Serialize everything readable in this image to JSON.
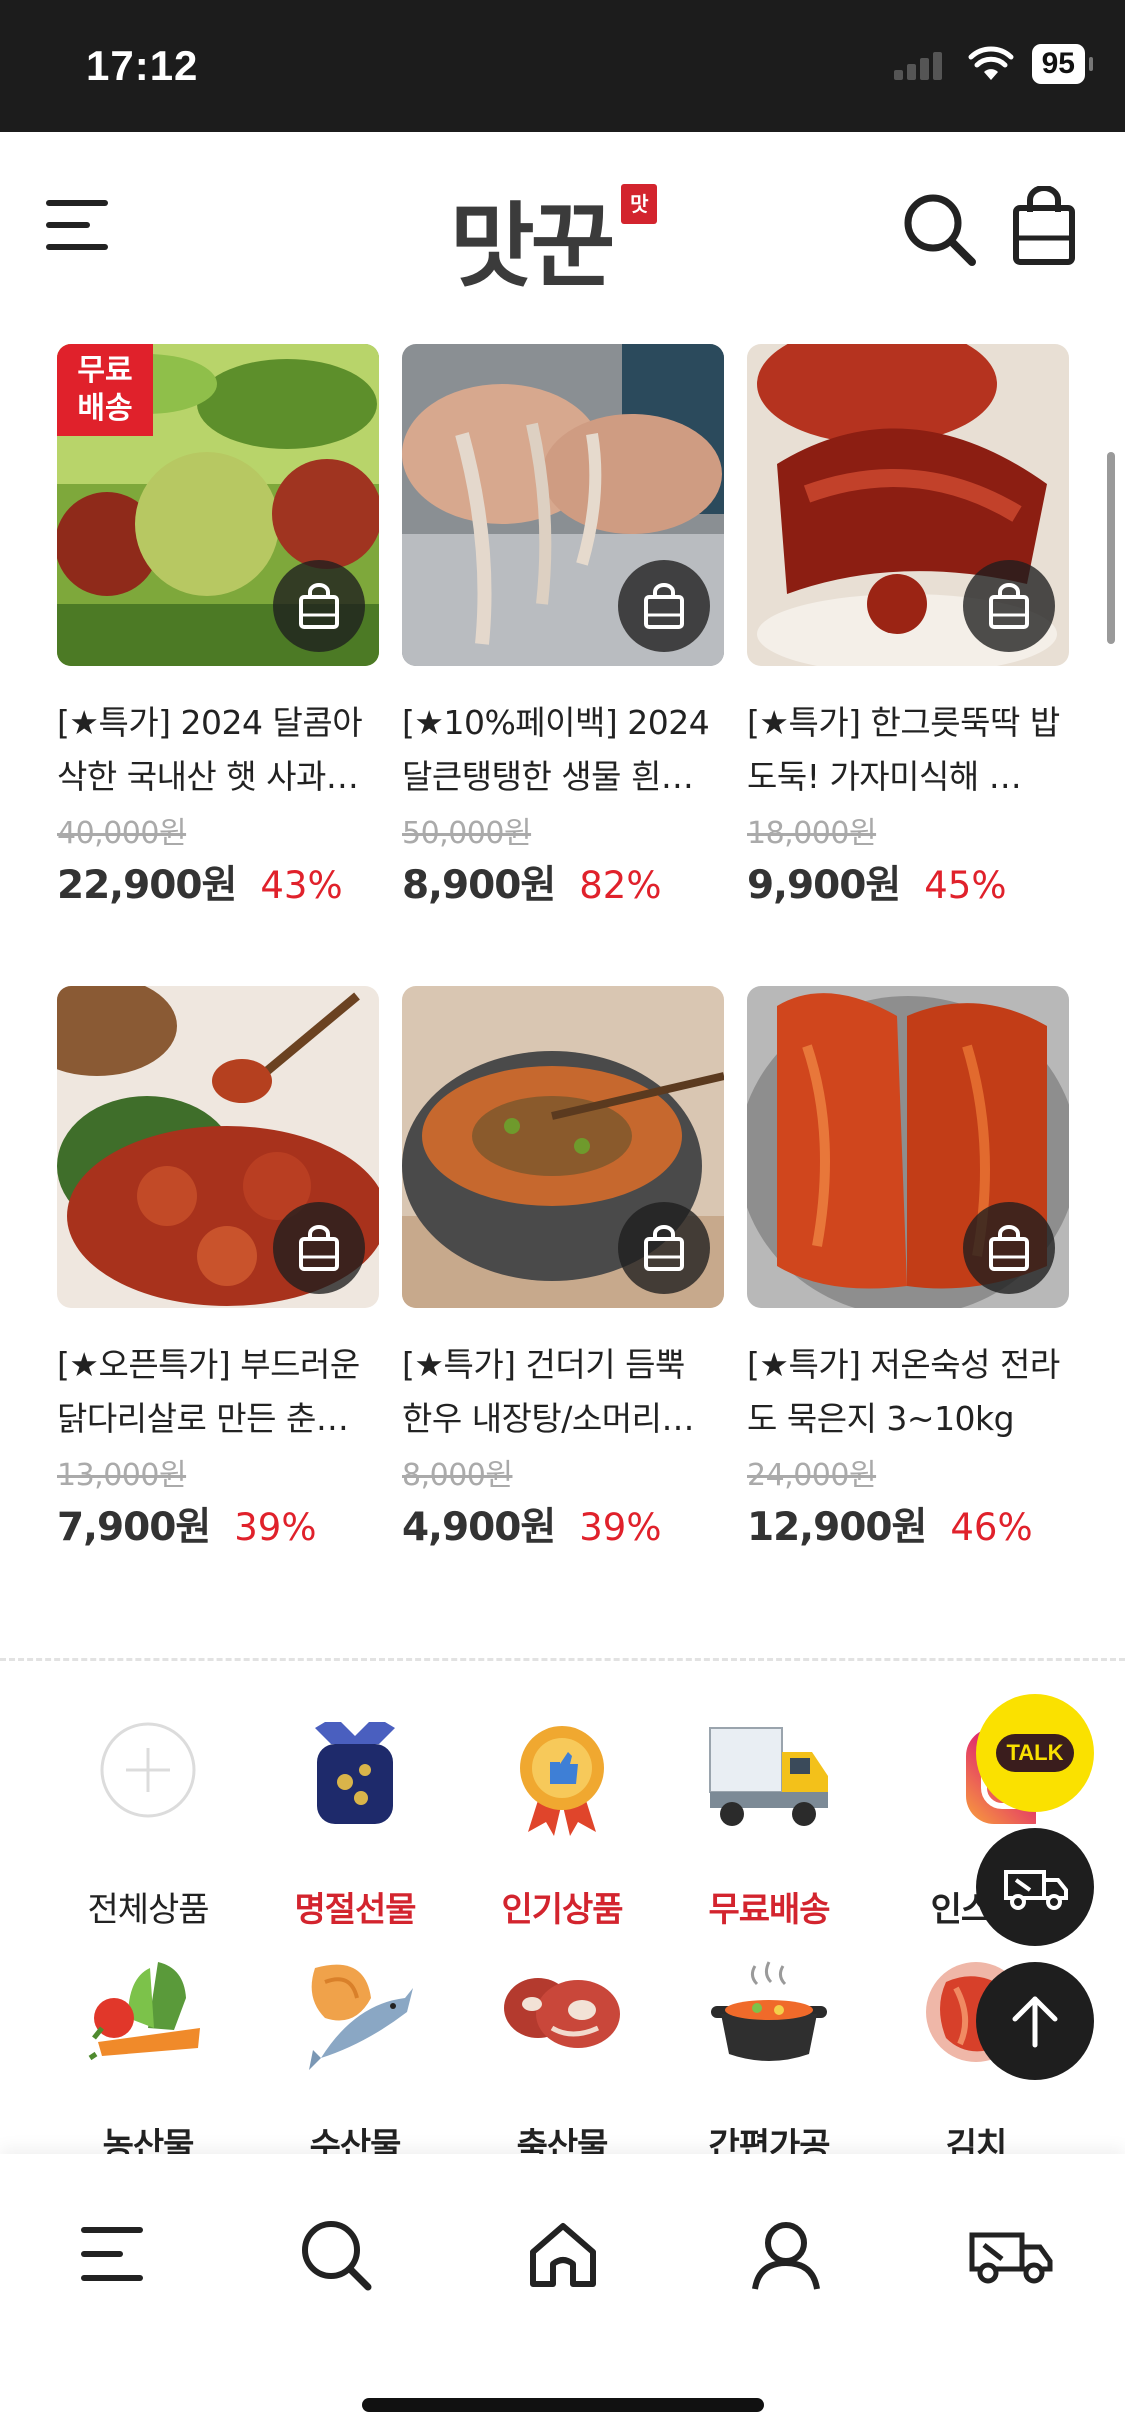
{
  "status_bar": {
    "time": "17:12",
    "battery": "95"
  },
  "header": {
    "logo_text": "맛꾼",
    "logo_seal": "맛"
  },
  "products": [
    {
      "name": "[★특가] 2024 달콤아삭한 국내산 햇 사과…",
      "original_price": "40,000원",
      "price": "22,900원",
      "discount": "43%",
      "badge": "무료 배송"
    },
    {
      "name": "[★10%페이백] 2024 달큰탱탱한 생물 흰…",
      "original_price": "50,000원",
      "price": "8,900원",
      "discount": "82%"
    },
    {
      "name": "[★특가] 한그릇뚝딱 밥도둑! 가자미식해 …",
      "original_price": "18,000원",
      "price": "9,900원",
      "discount": "45%"
    },
    {
      "name": "[★오픈특가] 부드러운 닭다리살로 만든 춘…",
      "original_price": "13,000원",
      "price": "7,900원",
      "discount": "39%"
    },
    {
      "name": "[★특가] 건더기 듬뿍 한우 내장탕/소머리…",
      "original_price": "8,000원",
      "price": "4,900원",
      "discount": "39%"
    },
    {
      "name": "[★특가] 저온숙성 전라도 묵은지 3~10kg",
      "original_price": "24,000원",
      "price": "12,900원",
      "discount": "46%"
    }
  ],
  "categories_row1": [
    {
      "label": "전체상품",
      "icon": "plus-circle-icon"
    },
    {
      "label": "명절선물",
      "icon": "gift-bag-icon"
    },
    {
      "label": "인기상품",
      "icon": "thumbs-up-medal-icon"
    },
    {
      "label": "무료배송",
      "icon": "truck-icon"
    },
    {
      "label": "인스타",
      "icon": "instagram-icon"
    }
  ],
  "categories_row2": [
    {
      "label": "농산물",
      "icon": "vegetables-icon"
    },
    {
      "label": "수산물",
      "icon": "seafood-icon"
    },
    {
      "label": "축산물",
      "icon": "meat-icon"
    },
    {
      "label": "간편가공",
      "icon": "pot-icon"
    },
    {
      "label": "김치",
      "icon": "kimchi-icon"
    }
  ],
  "fab": {
    "talk": "TALK"
  },
  "colors": {
    "accent": "#e0212b",
    "brand_red": "#d3242e",
    "talk_yellow": "#fae100"
  }
}
